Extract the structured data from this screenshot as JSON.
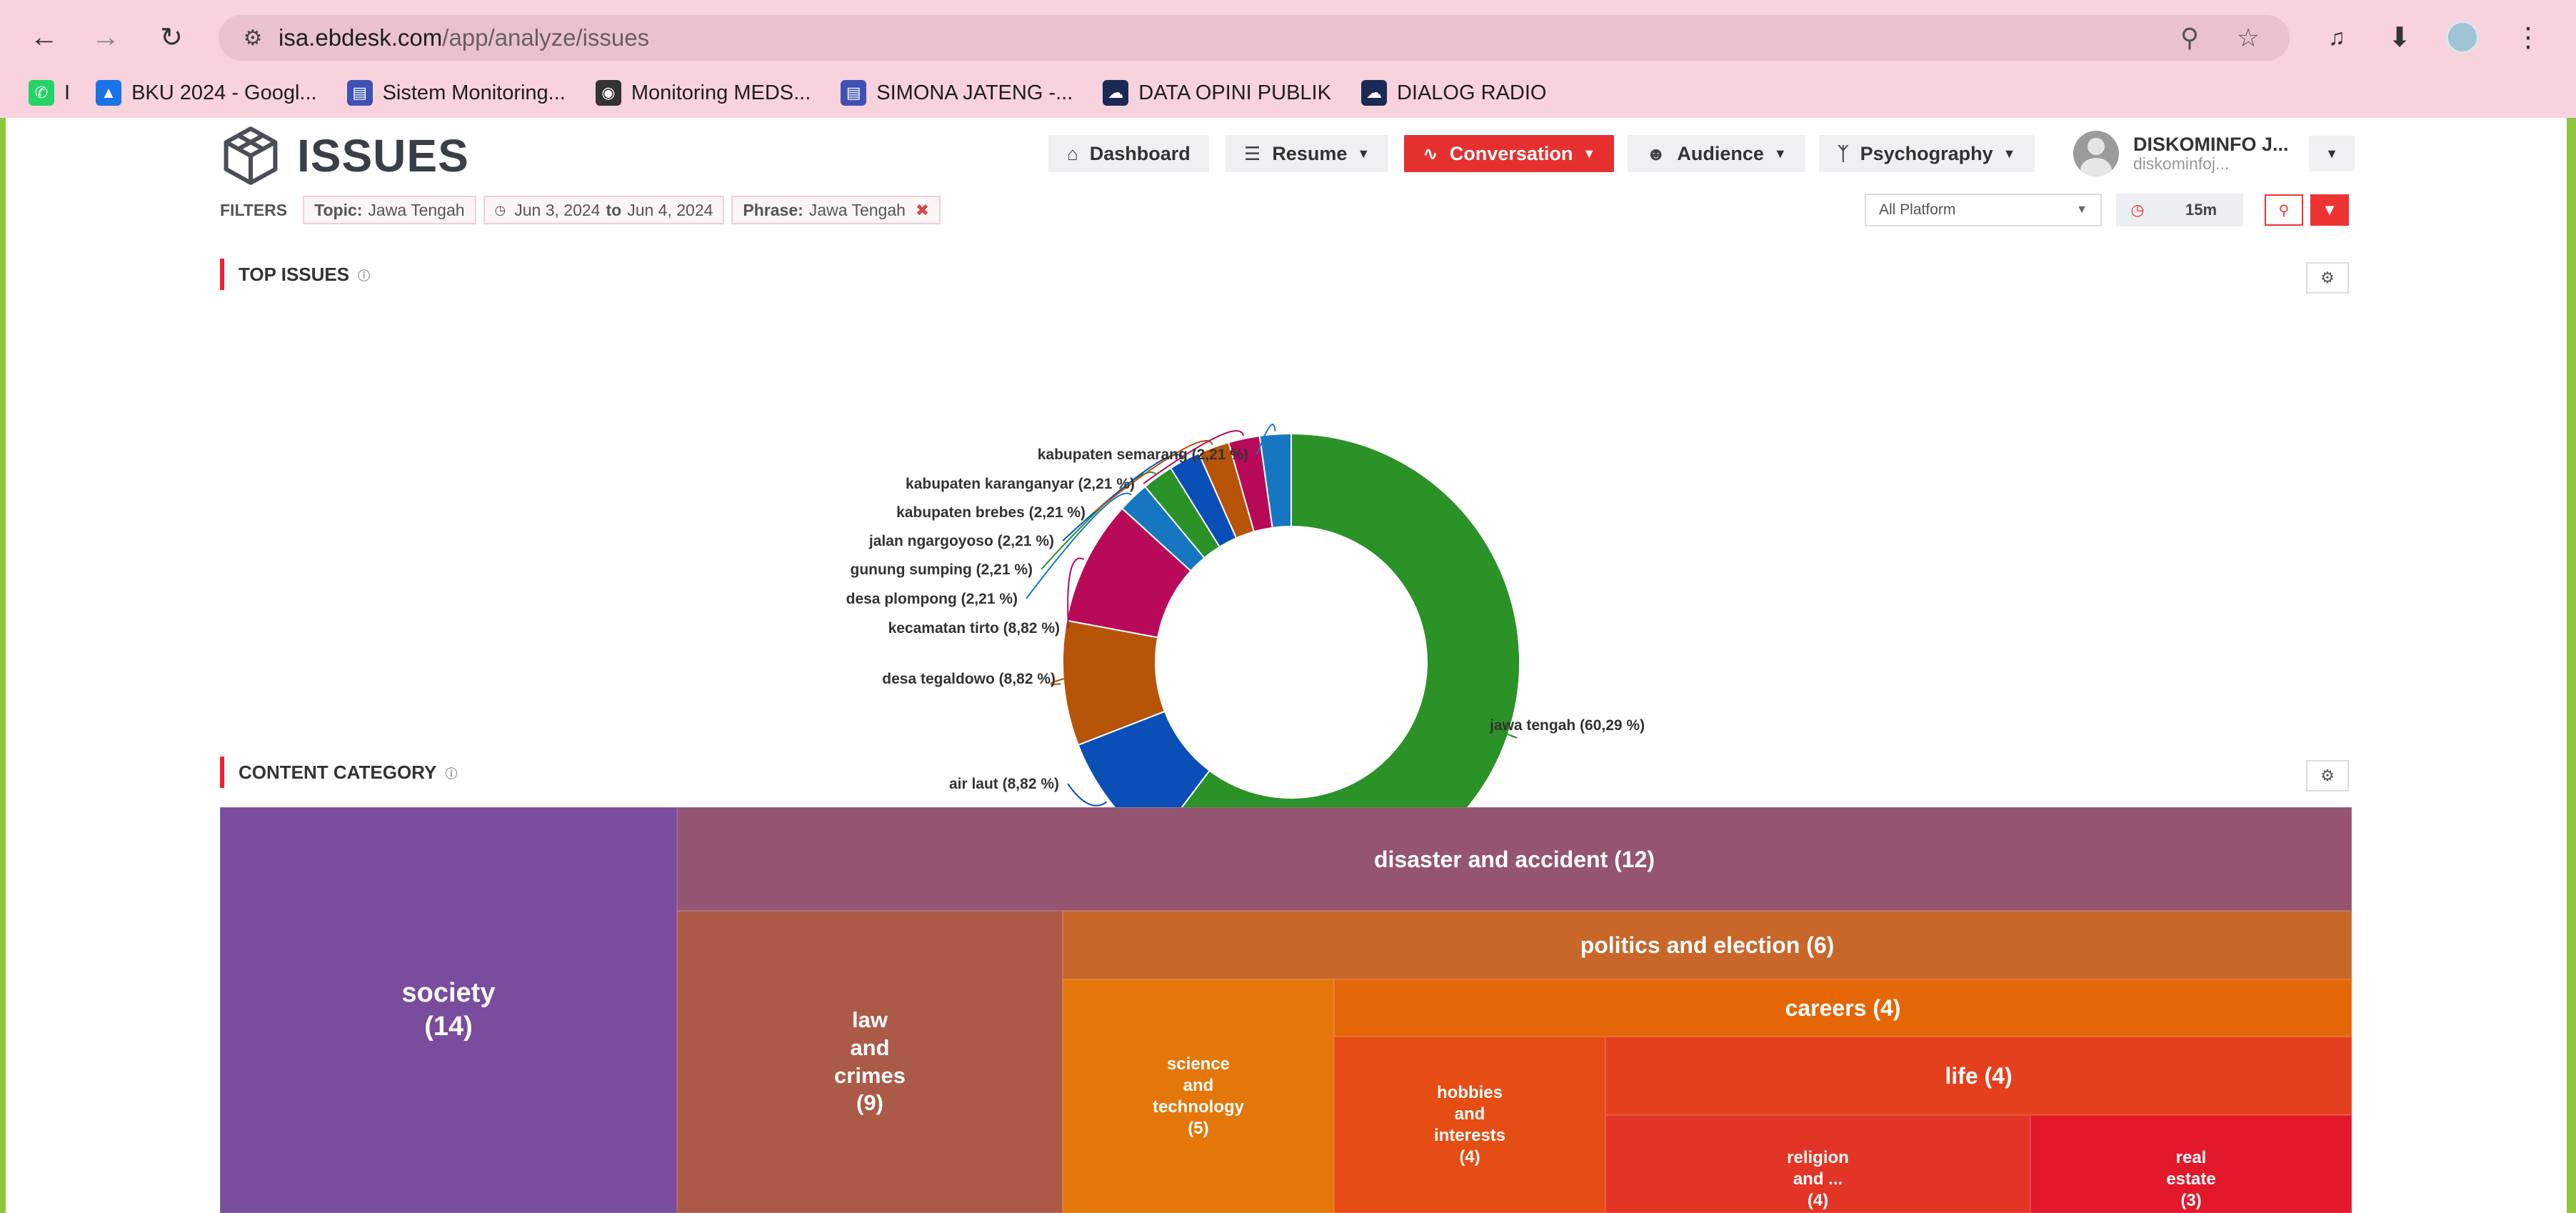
{
  "browser": {
    "url_host": "isa.ebdesk.com",
    "url_path": "/app/analyze/issues",
    "bookmarks": [
      {
        "label": "I",
        "icon": "whatsapp-icon",
        "color": "#25d366"
      },
      {
        "label": "BKU 2024 - Googl...",
        "icon": "google-drive-icon",
        "color": "#1a73e8"
      },
      {
        "label": "Sistem Monitoring...",
        "icon": "form-icon",
        "color": "#3f51b5"
      },
      {
        "label": "Monitoring MEDS...",
        "icon": "globe-icon",
        "color": "#333"
      },
      {
        "label": "SIMONA JATENG -...",
        "icon": "form-icon",
        "color": "#3f51b5"
      },
      {
        "label": "DATA OPINI PUBLIK",
        "icon": "cloud-icon",
        "color": "#1b2a55"
      },
      {
        "label": "DIALOG RADIO",
        "icon": "cloud-icon",
        "color": "#1b2a55"
      }
    ]
  },
  "app": {
    "title": "ISSUES",
    "nav": [
      {
        "label": "Dashboard",
        "icon": "home-icon",
        "active": false,
        "caret": false
      },
      {
        "label": "Resume",
        "icon": "book-icon",
        "active": false,
        "caret": true
      },
      {
        "label": "Conversation",
        "icon": "pulse-icon",
        "active": true,
        "caret": true
      },
      {
        "label": "Audience",
        "icon": "user-circle-icon",
        "active": false,
        "caret": true
      },
      {
        "label": "Psychography",
        "icon": "branch-icon",
        "active": false,
        "caret": true
      }
    ],
    "user": {
      "name": "DISKOMINFO J...",
      "sub": "diskominfoj..."
    }
  },
  "filters": {
    "label": "FILTERS",
    "topic_key": "Topic:",
    "topic_value": "Jawa Tengah",
    "date_from": "Jun 3, 2024",
    "date_to_word": "to",
    "date_to": "Jun 4, 2024",
    "phrase_key": "Phrase:",
    "phrase_value": "Jawa Tengah",
    "platform": "All Platform",
    "interval": "15m"
  },
  "sections": {
    "top_issues": "TOP ISSUES",
    "content_category": "CONTENT CATEGORY"
  },
  "chart_data": [
    {
      "type": "pie",
      "donut": true,
      "title": "TOP ISSUES",
      "slices": [
        {
          "label": "jawa tengah (60,29 %)",
          "name": "jawa tengah",
          "value": 60.29,
          "color": "#2a9226"
        },
        {
          "label": "air laut (8,82 %)",
          "name": "air laut",
          "value": 8.82,
          "color": "#0a4fb8"
        },
        {
          "label": "desa tegaldowo (8,82 %)",
          "name": "desa tegaldowo",
          "value": 8.82,
          "color": "#b75408"
        },
        {
          "label": "kecamatan tirto (8,82 %)",
          "name": "kecamatan tirto",
          "value": 8.82,
          "color": "#b80a58"
        },
        {
          "label": "desa plompong (2,21 %)",
          "name": "desa plompong",
          "value": 2.21,
          "color": "#1677c0"
        },
        {
          "label": "gunung sumping (2,21 %)",
          "name": "gunung sumping",
          "value": 2.21,
          "color": "#2a9226"
        },
        {
          "label": "jalan ngargoyoso (2,21 %)",
          "name": "jalan ngargoyoso",
          "value": 2.21,
          "color": "#0a4fb8"
        },
        {
          "label": "kabupaten brebes (2,21 %)",
          "name": "kabupaten brebes",
          "value": 2.21,
          "color": "#b75408"
        },
        {
          "label": "kabupaten karanganyar (2,21 %)",
          "name": "kabupaten karanganyar",
          "value": 2.21,
          "color": "#b80a58"
        },
        {
          "label": "kabupaten semarang (2,21 %)",
          "name": "kabupaten semarang",
          "value": 2.21,
          "color": "#1677c0"
        }
      ]
    },
    {
      "type": "treemap",
      "title": "CONTENT CATEGORY",
      "items": [
        {
          "label": "society\n(14)",
          "name": "society",
          "value": 14,
          "color": "#7a4c9e"
        },
        {
          "label": "disaster and accident (12)",
          "name": "disaster and accident",
          "value": 12,
          "color": "#955472"
        },
        {
          "label": "law\nand\ncrimes\n(9)",
          "name": "law and crimes",
          "value": 9,
          "color": "#ac5a48"
        },
        {
          "label": "politics and election (6)",
          "name": "politics and election",
          "value": 6,
          "color": "#c9662a"
        },
        {
          "label": "science\nand\ntechnology\n(5)",
          "name": "science and technology",
          "value": 5,
          "color": "#e47709"
        },
        {
          "label": "careers (4)",
          "name": "careers",
          "value": 4,
          "color": "#e46607"
        },
        {
          "label": "hobbies\nand\ninterests\n(4)",
          "name": "hobbies and interests",
          "value": 4,
          "color": "#e54d14"
        },
        {
          "label": "life (4)",
          "name": "life",
          "value": 4,
          "color": "#e5401e"
        },
        {
          "label": "religion\nand ...\n(4)",
          "name": "religion and ...",
          "value": 4,
          "color": "#e33526"
        },
        {
          "label": "real\nestate\n(3)",
          "name": "real estate",
          "value": 3,
          "color": "#e3182a"
        }
      ]
    }
  ]
}
